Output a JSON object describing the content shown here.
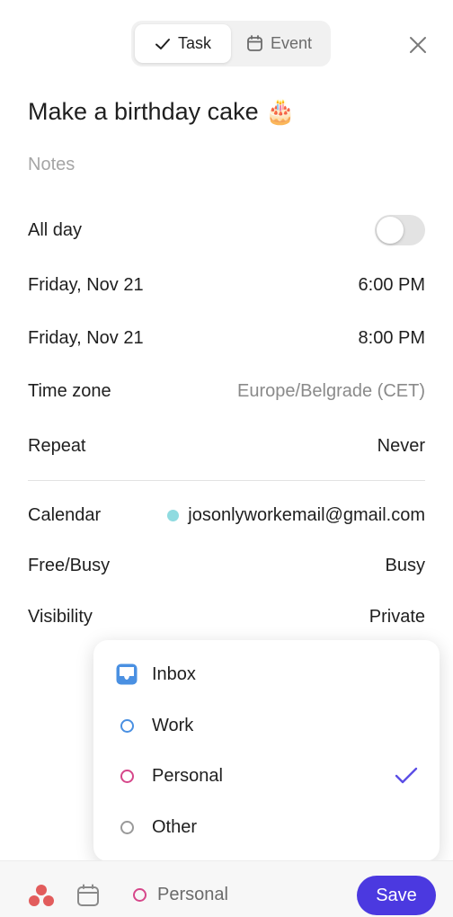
{
  "header": {
    "tabs": [
      {
        "label": "Task",
        "icon": "check-icon",
        "active": true
      },
      {
        "label": "Event",
        "icon": "calendar-icon",
        "active": false
      }
    ],
    "close_icon": "close-icon"
  },
  "task": {
    "title": "Make a birthday cake 🎂",
    "notes_placeholder": "Notes"
  },
  "fields": {
    "all_day": {
      "label": "All day",
      "enabled": false
    },
    "start": {
      "date": "Friday, Nov 21",
      "time": "6:00 PM"
    },
    "end": {
      "date": "Friday, Nov 21",
      "time": "8:00 PM"
    },
    "time_zone": {
      "label": "Time zone",
      "value": "Europe/Belgrade (CET)"
    },
    "repeat": {
      "label": "Repeat",
      "value": "Never"
    },
    "calendar": {
      "label": "Calendar",
      "value": "josonlyworkemail@gmail.com",
      "color": "#8fdbe0"
    },
    "free_busy": {
      "label": "Free/Busy",
      "value": "Busy"
    },
    "visibility": {
      "label": "Visibility",
      "value": "Private"
    }
  },
  "project_menu": {
    "items": [
      {
        "label": "Inbox",
        "icon": "inbox-icon",
        "color": "#4a90e2",
        "selected": false
      },
      {
        "label": "Work",
        "icon": "circle-icon",
        "color": "#4a90e2",
        "selected": false
      },
      {
        "label": "Personal",
        "icon": "circle-icon",
        "color": "#d6478a",
        "selected": true
      },
      {
        "label": "Other",
        "icon": "circle-icon",
        "color": "#999999",
        "selected": false
      }
    ],
    "check_color": "#5b4ee6"
  },
  "bottom_bar": {
    "project_label": "Personal",
    "project_color": "#d6478a",
    "save_label": "Save",
    "accent": "#4b39e0"
  }
}
